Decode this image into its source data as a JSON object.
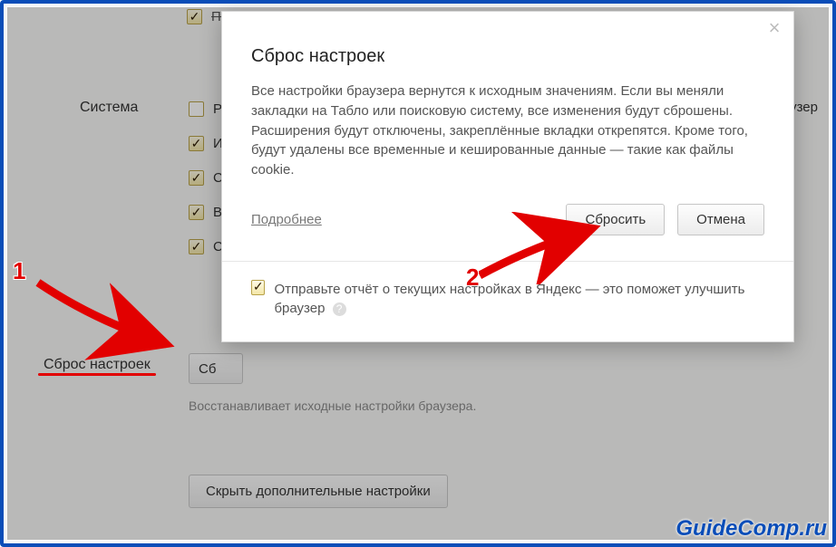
{
  "bg": {
    "top_cb_text": "Показывать иконку браузера",
    "system_label": "Система",
    "checkbox_letters": [
      "Р",
      "И",
      "С",
      "В",
      "С"
    ],
    "reset_label": "Сброс настроек",
    "reset_btn_partial": "Сб",
    "reset_desc": "Восстанавливает исходные настройки браузера.",
    "hide_btn": "Скрыть дополнительные настройки",
    "trailing_text": "раузер"
  },
  "dialog": {
    "title": "Сброс настроек",
    "body": "Все настройки браузера вернутся к исходным значениям. Если вы меняли закладки на Табло или поисковую систему, все изменения будут сброшены. Расширения будут отключены, закреплённые вкладки открепятся. Кроме того, будут удалены все временные и кешированные данные — такие как файлы cookie.",
    "more_link": "Подробнее",
    "confirm_btn": "Сбросить",
    "cancel_btn": "Отмена",
    "report_cb_text": "Отправьте отчёт о текущих настройках в Яндекс — это поможет улучшить браузер",
    "help_mark": "?"
  },
  "annotations": {
    "n1": "1",
    "n2": "2"
  },
  "watermark": "GuideComp.ru"
}
